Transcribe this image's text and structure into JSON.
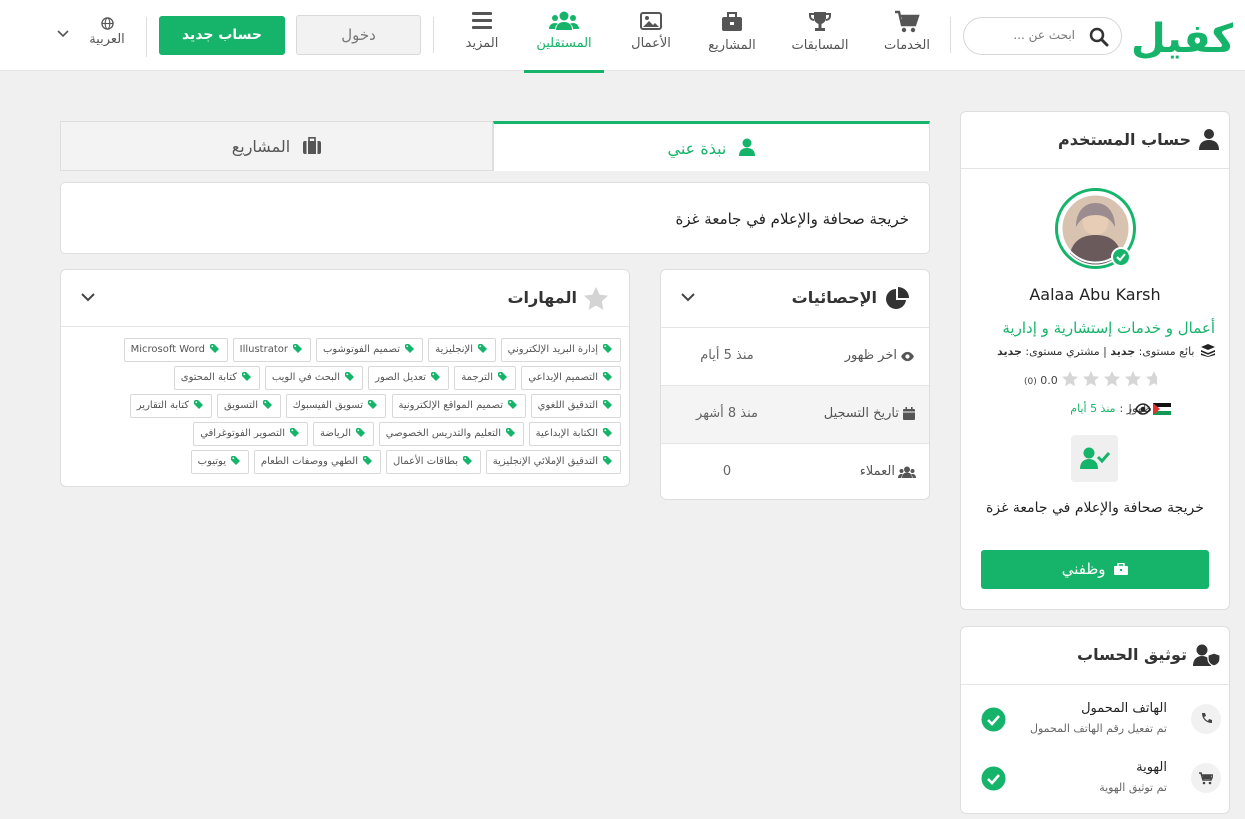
{
  "header": {
    "logo_text": "كفيل",
    "search_placeholder": "ابحث عن ...",
    "nav": [
      {
        "label": "الخدمات",
        "icon": "cart-icon"
      },
      {
        "label": "المسابقات",
        "icon": "trophy-icon"
      },
      {
        "label": "المشاريع",
        "icon": "briefcase-icon"
      },
      {
        "label": "الأعمال",
        "icon": "image-icon"
      },
      {
        "label": "المستقلين",
        "icon": "users-icon",
        "active": true
      },
      {
        "label": "المزيد",
        "icon": "menu-icon"
      }
    ],
    "login_label": "دخول",
    "signup_label": "حساب جديد",
    "language_label": "العربية"
  },
  "colors": {
    "accent": "#16b46a",
    "text": "#333333",
    "background": "#f0f0f0"
  },
  "user_card": {
    "title": "حساب المستخدم",
    "name": "Aalaa Abu Karsh",
    "specialty": "أعمال و خدمات إستشارية و إدارية",
    "seller_level_label": "بائع مستوى:",
    "seller_level": "جديد",
    "buyer_level_label": "| مشتري مستوى:",
    "buyer_level": "جديد",
    "rating_value": "0.0",
    "rating_count": "(0)",
    "rating_stars": 0,
    "last_seen_label": "اخر ظهور :",
    "last_seen": "منذ 5 أيام",
    "separator": "|",
    "bio": "خريجة صحافة والإعلام في جامعة غزة",
    "hire_button": "وظفني"
  },
  "verification": {
    "title": "توثيق الحساب",
    "items": [
      {
        "title": "الهاتف المحمول",
        "subtitle": "تم تفعيل رقم الهاتف المحمول",
        "icon": "phone-icon"
      },
      {
        "title": "الهوية",
        "subtitle": "تم توثيق الهوية",
        "icon": "cart-icon"
      }
    ]
  },
  "tabs": [
    {
      "label": "نبذة عني",
      "active": true
    },
    {
      "label": "المشاريع",
      "active": false
    }
  ],
  "about_text": "خريجة صحافة والإعلام في جامعة غزة",
  "stats": {
    "title": "الإحصائيات",
    "rows": [
      {
        "label": "اخر ظهور",
        "value": "منذ 5 أيام"
      },
      {
        "label": "تاريخ التسجيل",
        "value": "منذ 8 أشهر"
      },
      {
        "label": "العملاء",
        "value": "0"
      }
    ]
  },
  "skills": {
    "title": "المهارات",
    "rows": [
      [
        "إدارة البريد الإلكتروني",
        "الإنجليزية",
        "تصميم الفوتوشوب",
        "Illustrator",
        "Microsoft Word"
      ],
      [
        "التصميم الإبداعي",
        "الترجمة",
        "تعديل الصور",
        "البحث في الويب",
        "كتابة المحتوى"
      ],
      [
        "التدقيق اللغوي",
        "تصميم المواقع الإلكترونية",
        "تسويق الفيسبوك",
        "التسويق",
        "كتابة التقارير"
      ],
      [
        "الكتابة الإبداعية",
        "التعليم والتدريس الخصوصي",
        "الرياضة",
        "التصوير الفوتوغرافي"
      ],
      [
        "التدقيق الإملائي الإنجليزية",
        "بطاقات الأعمال",
        "الطهي ووصفات الطعام",
        "يوتيوب"
      ]
    ]
  }
}
